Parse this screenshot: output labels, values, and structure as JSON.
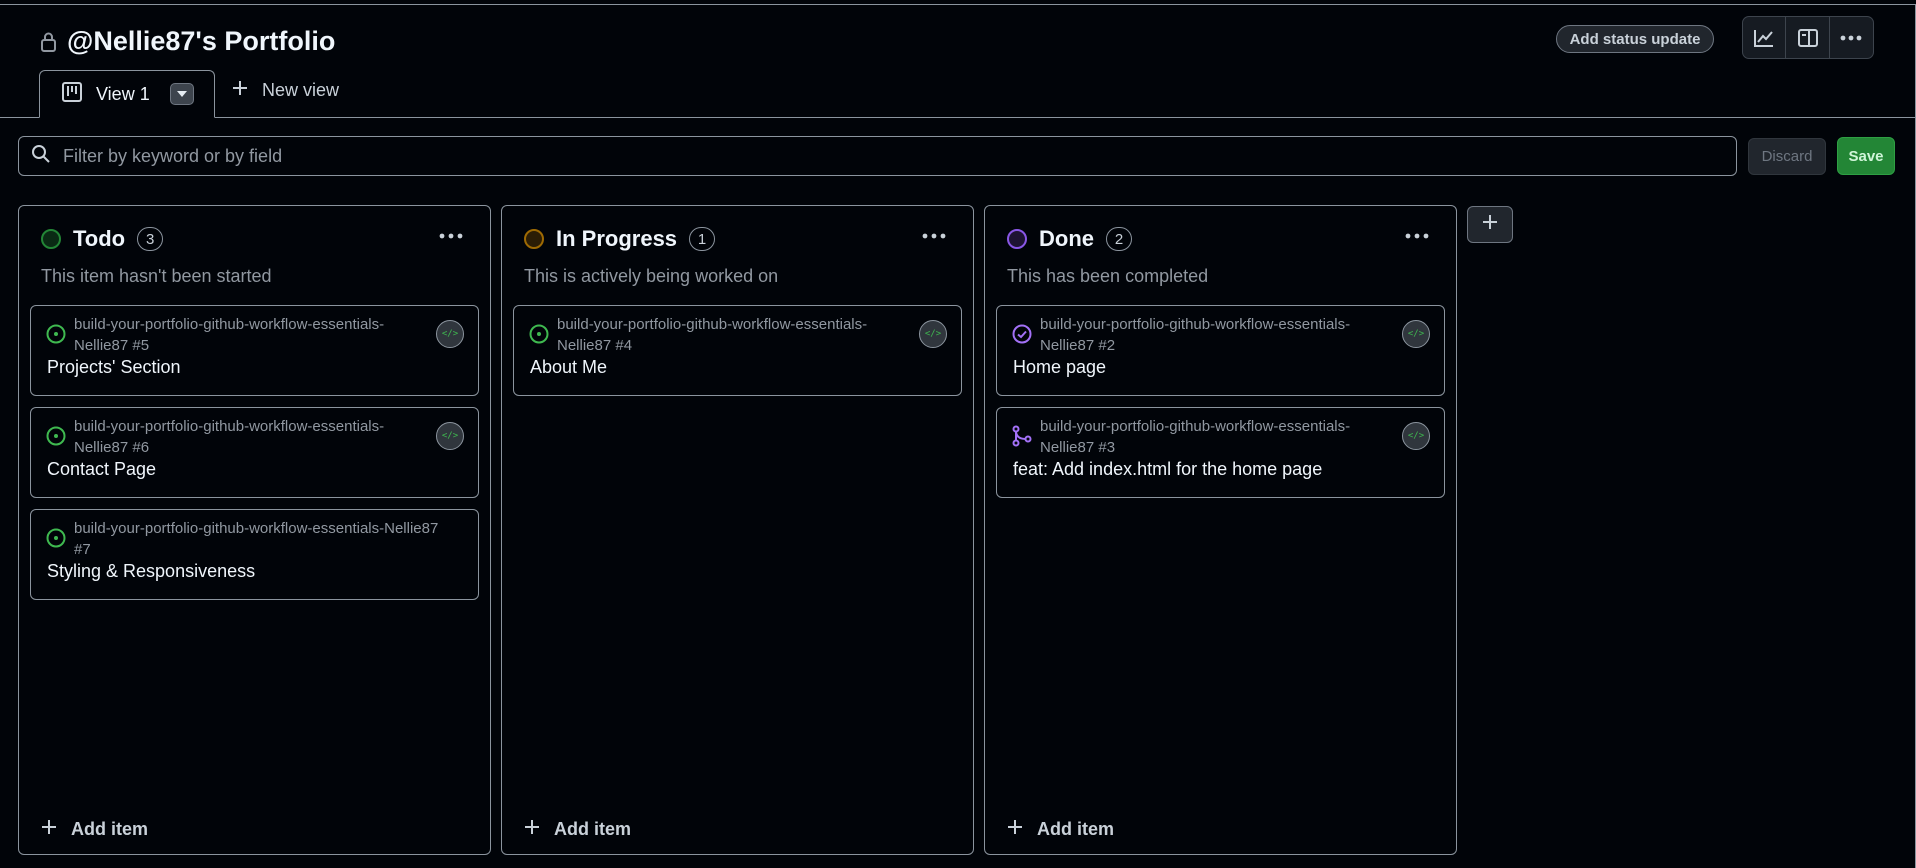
{
  "header": {
    "title": "@Nellie87's Portfolio",
    "status_button": "Add status update"
  },
  "tabs": {
    "active_label": "View 1",
    "new_view_label": "New view"
  },
  "filter": {
    "placeholder": "Filter by keyword or by field",
    "discard_label": "Discard",
    "save_label": "Save"
  },
  "columns": [
    {
      "title": "Todo",
      "count": "3",
      "description": "This item hasn't been started",
      "color": "#238636",
      "add_item_label": "Add item",
      "cards": [
        {
          "repo": "build-your-portfolio-github-workflow-essentials-Nellie87 #5",
          "title": "Projects' Section",
          "status_icon": "issue-open-icon",
          "avatar": "</>"
        },
        {
          "repo": "build-your-portfolio-github-workflow-essentials-Nellie87 #6",
          "title": "Contact Page",
          "status_icon": "issue-open-icon",
          "avatar": "</>"
        },
        {
          "repo": "build-your-portfolio-github-workflow-essentials-Nellie87 #7",
          "title": "Styling & Responsiveness",
          "status_icon": "issue-open-icon"
        }
      ]
    },
    {
      "title": "In Progress",
      "count": "1",
      "description": "This is actively being worked on",
      "color": "#9e6a03",
      "add_item_label": "Add item",
      "cards": [
        {
          "repo": "build-your-portfolio-github-workflow-essentials-Nellie87 #4",
          "title": "About Me",
          "status_icon": "issue-open-icon",
          "avatar": "</>"
        }
      ]
    },
    {
      "title": "Done",
      "count": "2",
      "description": "This has been completed",
      "color": "#8957e5",
      "add_item_label": "Add item",
      "cards": [
        {
          "repo": "build-your-portfolio-github-workflow-essentials-Nellie87 #2",
          "title": "Home page",
          "status_icon": "issue-closed-icon",
          "avatar": "</>"
        },
        {
          "repo": "build-your-portfolio-github-workflow-essentials-Nellie87 #3",
          "title": "feat: Add index.html for the home page",
          "status_icon": "pull-request-merged-icon",
          "avatar": "</>"
        }
      ]
    }
  ],
  "colors": {
    "open": "#3fb950",
    "done": "#a371f7",
    "accent_save": "#238636"
  }
}
